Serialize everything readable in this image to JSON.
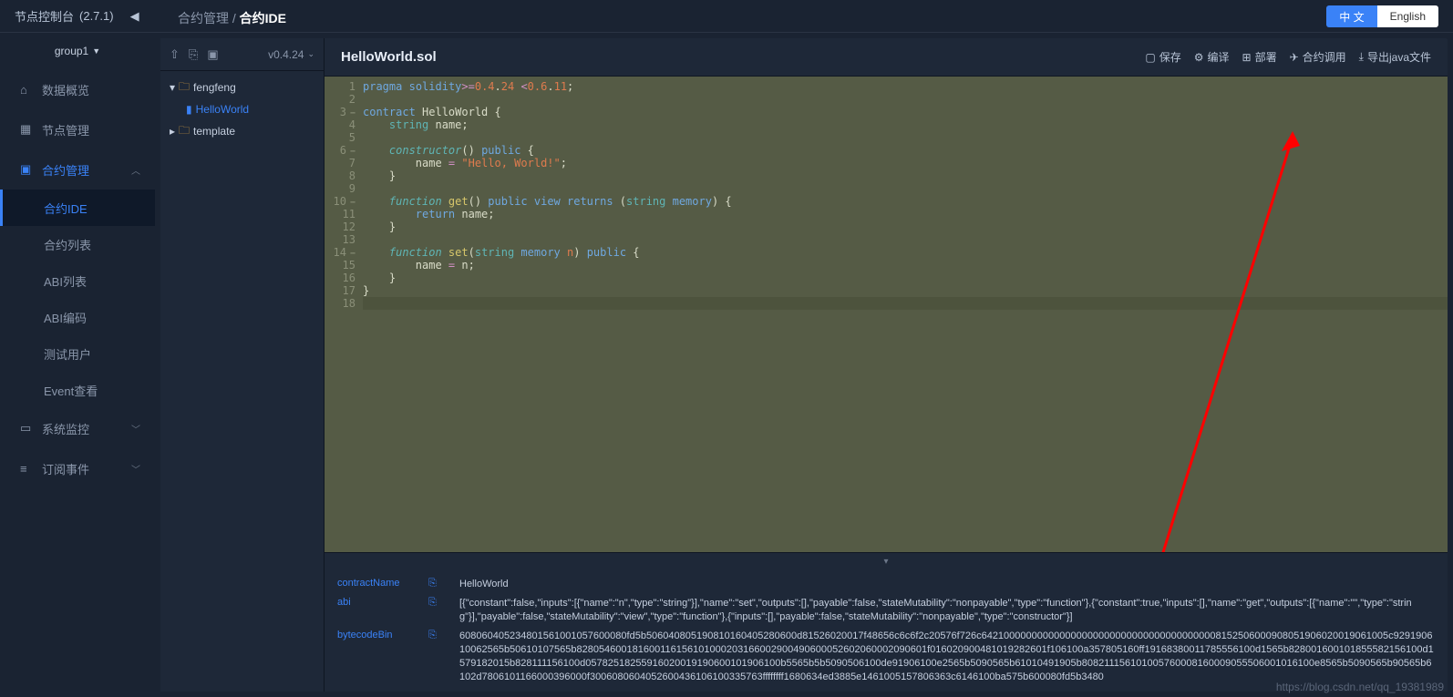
{
  "header": {
    "appTitle": "节点控制台",
    "version": "(2.7.1)",
    "breadcrumbParent": "合约管理",
    "breadcrumbCurrent": "合约IDE",
    "langZh": "中 文",
    "langEn": "English"
  },
  "groupSelector": "group1",
  "nav": {
    "overview": "数据概览",
    "nodeMgmt": "节点管理",
    "contractMgmt": "合约管理",
    "sub": {
      "ide": "合约IDE",
      "list": "合约列表",
      "abiList": "ABI列表",
      "abiEncode": "ABI编码",
      "testUser": "测试用户",
      "eventView": "Event查看"
    },
    "sysMonitor": "系统监控",
    "subscribe": "订阅事件"
  },
  "filetree": {
    "compilerVersion": "v0.4.24",
    "root": "fengfeng",
    "file": "HelloWorld",
    "folder2": "template"
  },
  "file": {
    "openName": "HelloWorld.sol"
  },
  "actions": {
    "save": "保存",
    "compile": "编译",
    "deploy": "部署",
    "call": "合约调用",
    "exportJava": "导出java文件"
  },
  "code": {
    "l1a": "pragma",
    "l1b": "solidity",
    "l1c": ">=",
    "l1d": "0.4",
    "l1e": ".",
    "l1f": "24",
    "l1g": " <",
    "l1h": "0.6",
    "l1i": ".",
    "l1j": "11",
    "l1k": ";",
    "l3a": "contract",
    "l3b": " HelloWorld {",
    "l4a": "string",
    "l4b": " name;",
    "l6a": "constructor",
    "l6b": "()",
    "l6c": " public",
    "l6d": " {",
    "l7a": "        name ",
    "l7b": "=",
    "l7c": " \"Hello, World!\"",
    "l7d": ";",
    "l8": "    }",
    "l10a": "function",
    "l10b": " get",
    "l10c": "()",
    "l10d": " public",
    "l10e": " view",
    "l10f": " returns",
    "l10g": " (",
    "l10h": "string",
    "l10i": " memory",
    "l10j": ") {",
    "l11a": "return",
    "l11b": " name;",
    "l12": "    }",
    "l14a": "function",
    "l14b": " set",
    "l14c": "(",
    "l14d": "string",
    "l14e": " memory",
    "l14f": " n",
    "l14g": ")",
    "l14h": " public",
    "l14i": " {",
    "l15a": "        name ",
    "l15b": "=",
    "l15c": " n;",
    "l16": "    }",
    "l17": "}"
  },
  "bottom": {
    "contractNameLabel": "contractName",
    "contractNameValue": "HelloWorld",
    "abiLabel": "abi",
    "abiValue": "[{\"constant\":false,\"inputs\":[{\"name\":\"n\",\"type\":\"string\"}],\"name\":\"set\",\"outputs\":[],\"payable\":false,\"stateMutability\":\"nonpayable\",\"type\":\"function\"},{\"constant\":true,\"inputs\":[],\"name\":\"get\",\"outputs\":[{\"name\":\"\",\"type\":\"string\"}],\"payable\":false,\"stateMutability\":\"view\",\"type\":\"function\"},{\"inputs\":[],\"payable\":false,\"stateMutability\":\"nonpayable\",\"type\":\"constructor\"}]",
    "bytecodeLabel": "bytecodeBin",
    "bytecodeValue": "608060405234801561001057600080fd5b506040805190810160405280600d81526020017f48656c6c6f2c20576f726c6421000000000000000000000000000000000000008152506000908051906020019061005c929190610062565b50610107565b828054600181600116156101000203166002900490600052602060002090601f016020900481019282601f106100a357805160ff19168380011785556100d1565b828001600101855582156100d1579182015b828111156100d05782518255916020019190600101906100b5565b5b5090506100de91906100e2565b5090565b61010491905b808211156101005760008160009055506001016100e8565b5090565b90565b6102d7806101166000396000f3006080604052600436106100335763ffffffff1680634ed3885e1461005157806363c6146100ba575b600080fd5b3480"
  },
  "watermark": "https://blog.csdn.net/qq_19381989"
}
